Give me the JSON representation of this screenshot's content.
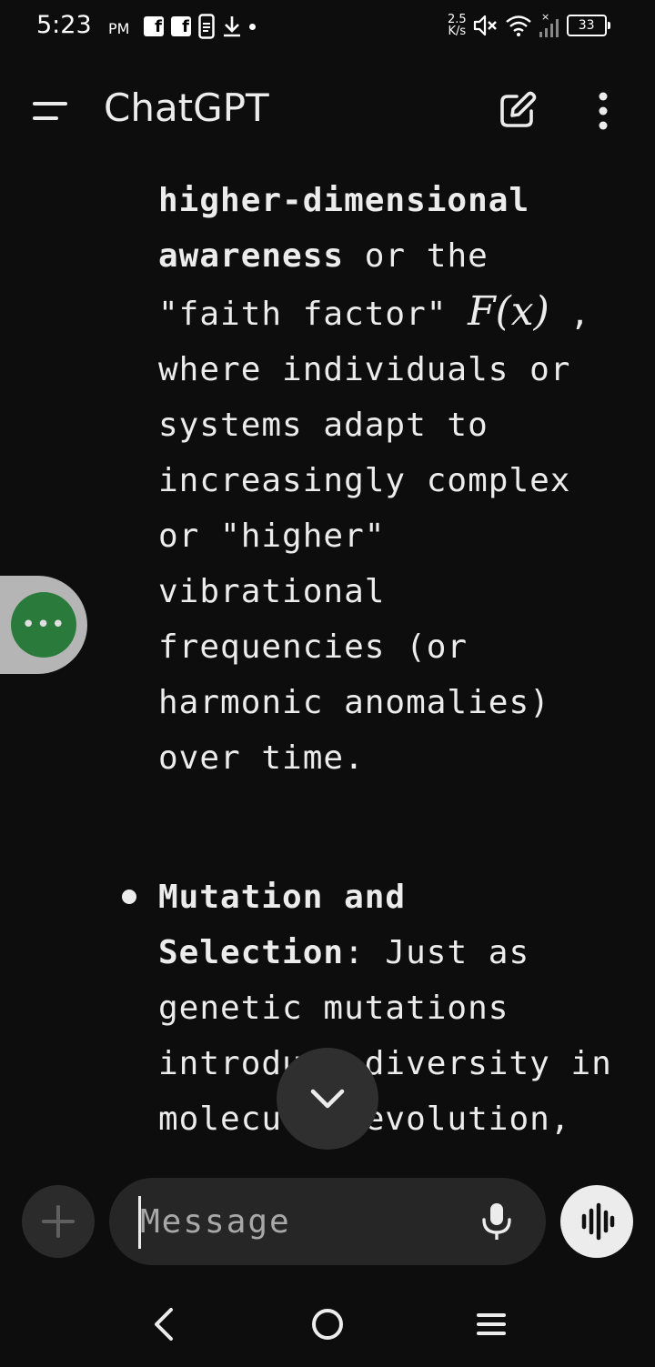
{
  "status_bar": {
    "time": "5:23",
    "ampm": "PM",
    "net_speed_top": "2.5",
    "net_speed_bottom": "K/s",
    "battery": "33",
    "icons": [
      "facebook-icon",
      "facebook-icon",
      "phone-clipboard-icon",
      "download-icon",
      "dot-icon",
      "mute-icon",
      "wifi-icon",
      "signal-icon",
      "battery-icon"
    ]
  },
  "header": {
    "title": "ChatGPT",
    "icons": [
      "menu-icon",
      "edit-icon",
      "more-vertical-icon"
    ]
  },
  "message": {
    "p1_bold1": "higher-dimensional",
    "p1_bold2": "awareness",
    "p1_text1": " or the \"faith factor\" ",
    "p1_math": "F(x)",
    "p1_text2": " , where individuals or systems adapt to increasingly complex or \"higher\" vibrational frequencies (or harmonic anomalies) over time.",
    "bullet_bold": "Mutation and Selection",
    "bullet_text": ": Just as genetic mutations introduce diversity in molecular evolution,"
  },
  "composer": {
    "placeholder": "Message",
    "icons": [
      "plus-icon",
      "mic-icon",
      "voice-waveform-icon"
    ]
  },
  "nav": {
    "icons": [
      "back-icon",
      "home-icon",
      "recents-icon"
    ]
  },
  "colors": {
    "background": "#0d0d0d",
    "text": "#ececec",
    "bubble_green": "#2a7a3c",
    "composer_bg": "#262626"
  }
}
